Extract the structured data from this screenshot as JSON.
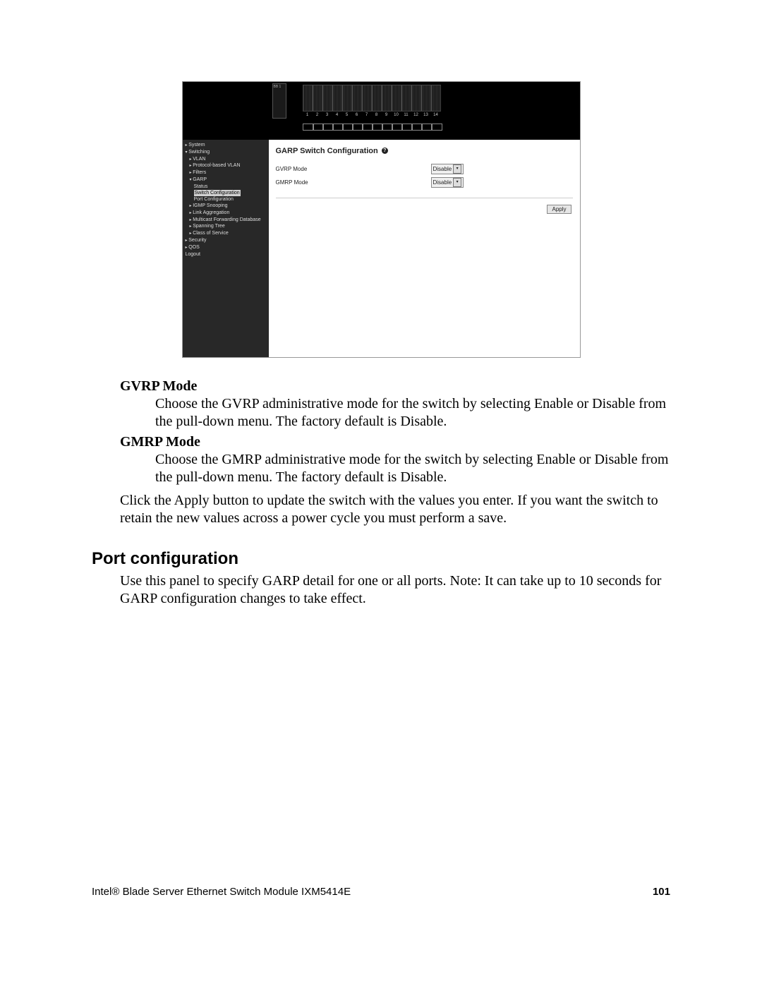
{
  "screenshot": {
    "port_numbers": [
      "1",
      "2",
      "3",
      "4",
      "5",
      "6",
      "7",
      "8",
      "9",
      "10",
      "11",
      "12",
      "13",
      "14"
    ],
    "sidebar": [
      {
        "label": "System",
        "cls": "l1 caret"
      },
      {
        "label": "Switching",
        "cls": "l1 caret-open"
      },
      {
        "label": "VLAN",
        "cls": "l2 caret"
      },
      {
        "label": "Protocol-based VLAN",
        "cls": "l2 caret"
      },
      {
        "label": "Filters",
        "cls": "l2 caret"
      },
      {
        "label": "GARP",
        "cls": "l2 caret-open"
      },
      {
        "label": "Status",
        "cls": "l3"
      },
      {
        "label": "Switch Configuration",
        "cls": "l3 active"
      },
      {
        "label": "Port Configuration",
        "cls": "l3"
      },
      {
        "label": "IGMP Snooping",
        "cls": "l2 caret"
      },
      {
        "label": "Link Aggregation",
        "cls": "l2 caret"
      },
      {
        "label": "Multicast Forwarding Database",
        "cls": "l2 caret"
      },
      {
        "label": "Spanning Tree",
        "cls": "l2 caret"
      },
      {
        "label": "Class of Service",
        "cls": "l2 caret"
      },
      {
        "label": "Security",
        "cls": "l1 caret"
      },
      {
        "label": "QOS",
        "cls": "l1 caret"
      },
      {
        "label": "Logout",
        "cls": "l1"
      }
    ],
    "title": "GARP Switch Configuration",
    "rows": [
      {
        "label": "GVRP Mode",
        "value": "Disable"
      },
      {
        "label": "GMRP Mode",
        "value": "Disable"
      }
    ],
    "apply": "Apply"
  },
  "terms": {
    "gvrp": {
      "title": "GVRP Mode",
      "body": "Choose the GVRP administrative mode for the switch by selecting Enable or Disable from the pull-down menu. The factory default is Disable."
    },
    "gmrp": {
      "title": "GMRP Mode",
      "body": "Choose the GMRP administrative mode for the switch by selecting Enable or Disable from the pull-down menu. The factory default is Disable."
    }
  },
  "apply_note": "Click the Apply button to update the switch with the values you enter. If you want the switch to retain the new values across a power cycle you must perform a save.",
  "section": {
    "title": "Port configuration",
    "body": "Use this panel to specify GARP detail for one or all ports. Note: It can take up to 10 seconds for GARP configuration changes to take effect."
  },
  "footer": {
    "doc": "Intel® Blade Server Ethernet Switch Module IXM5414E",
    "page": "101"
  }
}
